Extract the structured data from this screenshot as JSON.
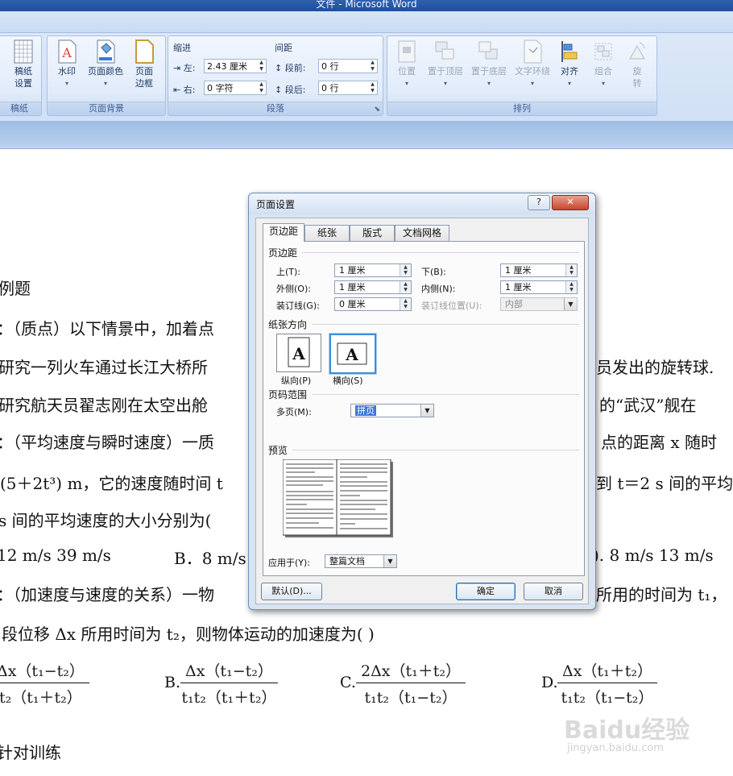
{
  "window": {
    "title": "文件 - Microsoft Word"
  },
  "ribbon": {
    "groups": {
      "gaozhi": {
        "label": "稿纸",
        "button": [
          "稿纸",
          "设置"
        ]
      },
      "page_background": {
        "label": "页面背景",
        "watermark": "水印",
        "page_color": "页面颜色",
        "page_border": [
          "页面",
          "边框"
        ]
      },
      "paragraph": {
        "label": "段落",
        "indent_heading": "缩进",
        "spacing_heading": "间距",
        "left_label": "左:",
        "left_value": "2.43 厘米",
        "right_label": "右:",
        "right_value": "0 字符",
        "before_label": "段前:",
        "before_value": "0 行",
        "after_label": "段后:",
        "after_value": "0 行"
      },
      "arrange": {
        "label": "排列",
        "position": "位置",
        "bring_front": "置于顶层",
        "send_back": "置于底层",
        "text_wrap": "文字环绕",
        "align": "对齐",
        "group": "组合",
        "rotate": [
          "旋",
          "转"
        ]
      }
    }
  },
  "document": {
    "lines": [
      "例题",
      "：（质点）以下情景中，加着点",
      "研究一列火车通过长江大桥所",
      "员发出的旋转球.",
      "研究航天员翟志刚在太空出舱",
      "的“武汉”舰在",
      "：（平均速度与瞬时速度）一质",
      "点的距离 x 随时",
      "(5＋2t³) m，它的速度随时间 t",
      "到 t＝2 s 间的平均",
      "s 间的平均速度的大小分别为(",
      "12 m/s   39 m/s",
      "B．8 m/s",
      ").  8 m/s    13 m/s",
      "：（加速度与速度的关系）一物",
      "所用的时间为 t₁，",
      "段位移 Δx 所用时间为 t₂，则物体运动的加速度为(        )",
      "针对训练"
    ],
    "answers": {
      "a": {
        "num": "Δx（t₁−t₂）",
        "den": "t₂（t₁＋t₂）"
      },
      "b": {
        "prefix": "B.",
        "num": "Δx（t₁−t₂）",
        "den": "t₁t₂（t₁＋t₂）"
      },
      "c": {
        "prefix": "C.",
        "num": "2Δx（t₁＋t₂）",
        "den": "t₁t₂（t₁−t₂）"
      },
      "d": {
        "prefix": "D.",
        "num": "Δx（t₁＋t₂）",
        "den": "t₁t₂（t₁−t₂）"
      }
    }
  },
  "dialog": {
    "title": "页面设置",
    "help": "?",
    "close": "✕",
    "tabs": [
      "页边距",
      "纸张",
      "版式",
      "文档网格"
    ],
    "margins": {
      "heading": "页边距",
      "top_label": "上(T):",
      "top_value": "1 厘米",
      "bottom_label": "下(B):",
      "bottom_value": "1 厘米",
      "outside_label": "外侧(O):",
      "outside_value": "1 厘米",
      "inside_label": "内侧(N):",
      "inside_value": "1 厘米",
      "gutter_label": "装订线(G):",
      "gutter_value": "0 厘米",
      "gutter_pos_label": "装订线位置(U):",
      "gutter_pos_value": "内部"
    },
    "orientation": {
      "heading": "纸张方向",
      "portrait": "纵向(P)",
      "landscape": "横向(S)",
      "glyph": "A"
    },
    "pages": {
      "heading": "页码范围",
      "multiple_label": "多页(M):",
      "multiple_value": "拼页"
    },
    "preview": {
      "heading": "预览"
    },
    "apply_label": "应用于(Y):",
    "apply_value": "整篇文档",
    "default_button": "默认(D)...",
    "ok_button": "确定",
    "cancel_button": "取消"
  },
  "watermark": {
    "text": "Baidu经验",
    "url_text": "jingyan.baidu.com"
  }
}
